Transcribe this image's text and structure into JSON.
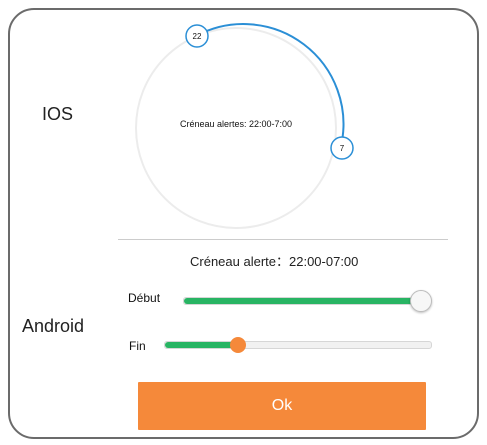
{
  "labels": {
    "ios": "IOS",
    "android": "Android"
  },
  "ios_picker": {
    "window_text": "Créneau alertes: 22:00-7:00",
    "start_hour": "22",
    "end_hour": "7"
  },
  "android_picker": {
    "summary": "Créneau alerte：22:00-07:00",
    "start_label": "Début",
    "end_label": "Fin",
    "start_fraction": 1.0,
    "end_fraction": 0.28
  },
  "buttons": {
    "ok": "Ok"
  },
  "colors": {
    "arc": "#2b8fd6",
    "slider_fill": "#28b463",
    "accent": "#f5893a"
  }
}
